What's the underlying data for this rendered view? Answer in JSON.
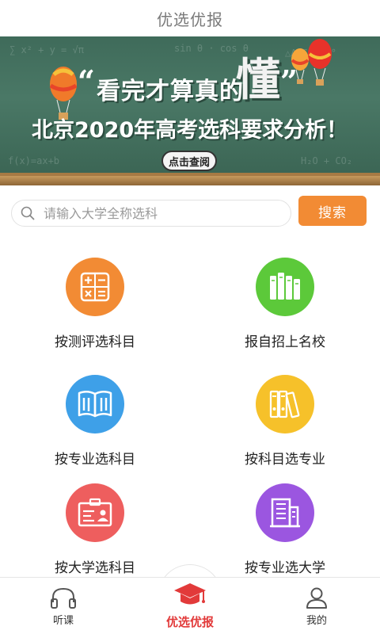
{
  "titlebar": {
    "title": "优选优报"
  },
  "banner": {
    "headline_main": "看完才算真的",
    "headline_emphasis": "懂",
    "headline_sub": "北京2020年高考选科要求分析！",
    "quote_open": "“",
    "quote_close": "”",
    "button_label": "点击查阅"
  },
  "search": {
    "placeholder": "请输入大学全称选科",
    "button_label": "搜索",
    "icon": "search-icon"
  },
  "menu": [
    {
      "id": "assessment",
      "label": "按测评选科目",
      "icon": "calculator-icon",
      "color": "#f28b34"
    },
    {
      "id": "self-enroll",
      "label": "报自招上名校",
      "icon": "books-icon",
      "color": "#5cc93a"
    },
    {
      "id": "by-major",
      "label": "按专业选科目",
      "icon": "open-book-icon",
      "color": "#3ea0e8"
    },
    {
      "id": "by-subject",
      "label": "按科目选专业",
      "icon": "binders-icon",
      "color": "#f6c12a"
    },
    {
      "id": "by-university",
      "label": "按大学选科目",
      "icon": "id-card-icon",
      "color": "#ee5e5e"
    },
    {
      "id": "major-to-university",
      "label": "按专业选大学",
      "icon": "building-icon",
      "color": "#9b56e0"
    }
  ],
  "tabbar": {
    "items": [
      {
        "id": "listen",
        "label": "听课",
        "icon": "headphones-icon",
        "active": false
      },
      {
        "id": "youxuan",
        "label": "优选优报",
        "icon": "graduation-cap-icon",
        "active": true
      },
      {
        "id": "mine",
        "label": "我的",
        "icon": "user-icon",
        "active": false
      }
    ],
    "active_color": "#e23a3a"
  }
}
